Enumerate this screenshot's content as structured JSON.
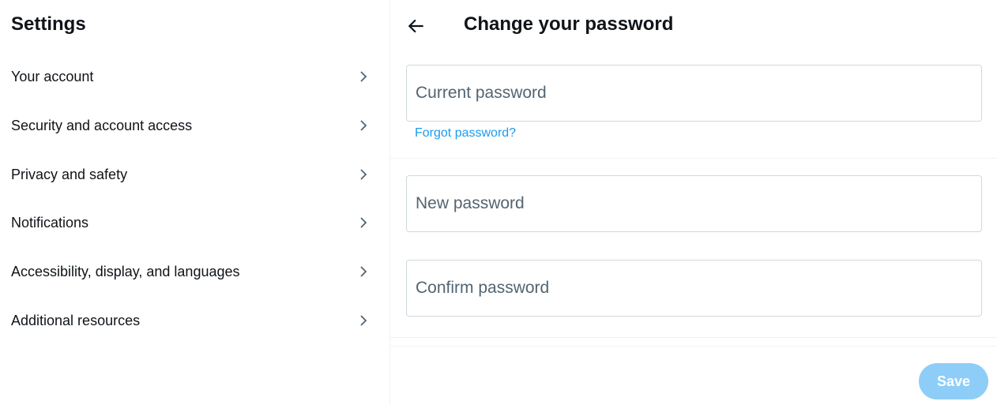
{
  "sidebar": {
    "title": "Settings",
    "items": [
      {
        "label": "Your account"
      },
      {
        "label": "Security and account access"
      },
      {
        "label": "Privacy and safety"
      },
      {
        "label": "Notifications"
      },
      {
        "label": "Accessibility, display, and languages"
      },
      {
        "label": "Additional resources"
      }
    ]
  },
  "main": {
    "title": "Change your password",
    "fields": {
      "current": {
        "placeholder": "Current password",
        "value": ""
      },
      "new": {
        "placeholder": "New password",
        "value": ""
      },
      "confirm": {
        "placeholder": "Confirm password",
        "value": ""
      }
    },
    "forgot_link": "Forgot password?",
    "save_label": "Save"
  },
  "colors": {
    "accent": "#1d9bf0",
    "save_disabled": "#8ecdf8"
  }
}
